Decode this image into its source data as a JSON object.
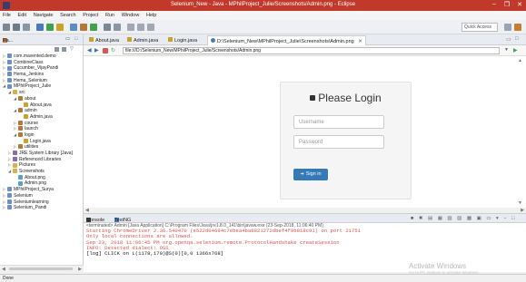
{
  "window": {
    "title": "Selenium_New - Java - MPhilProject_Julie/Screenshots/Admin.png - Eclipse",
    "minimize": "–",
    "maximize": "❐",
    "close": "✕"
  },
  "menu": [
    "File",
    "Edit",
    "Navigate",
    "Search",
    "Project",
    "Run",
    "Window",
    "Help"
  ],
  "toolbar": {
    "quick_access": "Quick Access"
  },
  "package_explorer": {
    "tab_label": "Pa...",
    "items": [
      {
        "label": "com.mavented.demo",
        "depth": 0,
        "expanded": false,
        "icon": "project"
      },
      {
        "label": "CombineClass",
        "depth": 0,
        "expanded": false,
        "icon": "project"
      },
      {
        "label": "Cucumber_VijayPandi",
        "depth": 0,
        "expanded": false,
        "icon": "project"
      },
      {
        "label": "Hema_Jenkins",
        "depth": 0,
        "expanded": false,
        "icon": "project"
      },
      {
        "label": "Hema_Selenium",
        "depth": 0,
        "expanded": false,
        "icon": "project"
      },
      {
        "label": "MPhilProject_Julie",
        "depth": 0,
        "expanded": true,
        "icon": "project"
      },
      {
        "label": "src",
        "depth": 1,
        "expanded": true,
        "icon": "folder"
      },
      {
        "label": "about",
        "depth": 2,
        "expanded": true,
        "icon": "package"
      },
      {
        "label": "About.java",
        "depth": 3,
        "expanded": null,
        "icon": "java"
      },
      {
        "label": "admin",
        "depth": 2,
        "expanded": true,
        "icon": "package"
      },
      {
        "label": "Admin.java",
        "depth": 3,
        "expanded": null,
        "icon": "java"
      },
      {
        "label": "course",
        "depth": 2,
        "expanded": false,
        "icon": "package"
      },
      {
        "label": "launch",
        "depth": 2,
        "expanded": false,
        "icon": "package"
      },
      {
        "label": "login",
        "depth": 2,
        "expanded": true,
        "icon": "package"
      },
      {
        "label": "Login.java",
        "depth": 3,
        "expanded": null,
        "icon": "java"
      },
      {
        "label": "utilities",
        "depth": 2,
        "expanded": false,
        "icon": "package"
      },
      {
        "label": "JRE System Library [Java]",
        "depth": 1,
        "expanded": false,
        "icon": "library"
      },
      {
        "label": "Referenced Libraries",
        "depth": 1,
        "expanded": false,
        "icon": "library"
      },
      {
        "label": "Pictures",
        "depth": 1,
        "expanded": false,
        "icon": "folder"
      },
      {
        "label": "Screenshots",
        "depth": 1,
        "expanded": true,
        "icon": "folder"
      },
      {
        "label": "About.png",
        "depth": 2,
        "expanded": null,
        "icon": "image"
      },
      {
        "label": "Admin.png",
        "depth": 2,
        "expanded": null,
        "icon": "image"
      },
      {
        "label": "MPhilProject_Surya",
        "depth": 0,
        "expanded": false,
        "icon": "project"
      },
      {
        "label": "Selenium",
        "depth": 0,
        "expanded": false,
        "icon": "project"
      },
      {
        "label": "Seleniumlearning",
        "depth": 0,
        "expanded": false,
        "icon": "project"
      },
      {
        "label": "Selenium_Pandi",
        "depth": 0,
        "expanded": false,
        "icon": "project"
      }
    ]
  },
  "editor_tabs": [
    {
      "label": "About.java",
      "active": false
    },
    {
      "label": "Admin.java",
      "active": false
    },
    {
      "label": "Login.java",
      "active": false
    },
    {
      "label": "D:\\Selenium_New\\MPhilProject_Julie\\Screenshots\\Admin.png",
      "active": true
    }
  ],
  "browser": {
    "url": "file:///D:/Selenium_New/MPhilProject_Julie/Screenshots/Admin.png"
  },
  "login": {
    "title": "Please Login",
    "username_placeholder": "Username",
    "password_placeholder": "Password",
    "sign_in_label": "Sign in"
  },
  "console": {
    "tab_console": "Console",
    "tab_tasks": "TestNG",
    "header": "<terminated> Admin [Java Application] C:\\Program Files\\Java\\jre1.8.0_141\\bin\\javaw.exe (23-Sep-2018, 11:06:40 PM)",
    "lines": [
      {
        "text": "Starting ChromeDriver 2.36.540470 (e522d04694c7ebea4ba8821272dbef4f9b818c91) on port 21751",
        "color": "#d9534f"
      },
      {
        "text": "Only local connections are allowed.",
        "color": "#d9534f"
      },
      {
        "text": "Sep 23, 2018 11:06:45 PM org.openqa.selenium.remote.ProtocolHandshake createSession",
        "color": "#d9534f"
      },
      {
        "text": "INFO: Detected dialect: OSS",
        "color": "#d9534f"
      },
      {
        "text": "[log] CLICK on L(1178,170)@S(0)[0,0 1366x768]",
        "color": "#222222"
      }
    ],
    "watermark_title": "Activate Windows",
    "watermark_sub": "Go to PC settings to activate Windows."
  },
  "status": {
    "text": "Done"
  },
  "colors": {
    "titlebar": "#c0392b",
    "login_button": "#337ab7",
    "console_error": "#d9534f"
  }
}
